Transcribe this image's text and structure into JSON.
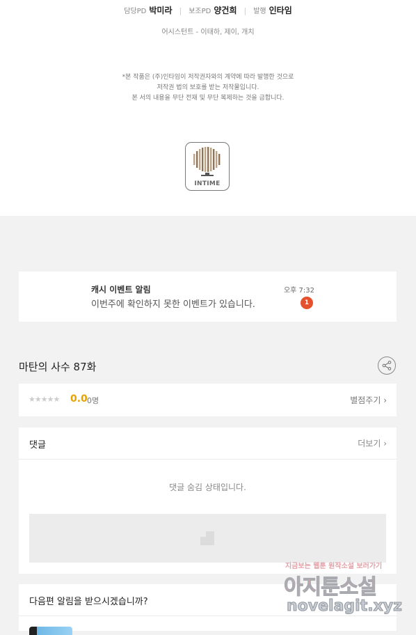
{
  "credits": {
    "lead_pd_role": "담당PD",
    "lead_pd_name": "박미라",
    "assist_pd_role": "보조PD",
    "assist_pd_name": "양건희",
    "publisher_role": "발행",
    "publisher_name": "인타임",
    "assistants": "어시스턴트 - 이태하, 제이, 개치"
  },
  "notice": {
    "line1": "*본 작품은 (주)인타임이 저작권자와의 계약에 따라 발행한 것으로",
    "line2": "저작권 법의 보호를 받는 저작물입니다.",
    "line3": "본 서의 내용을 무단 전재 및 무단 복제하는 것을 금합니다."
  },
  "logo": {
    "text": "INTIME"
  },
  "notification": {
    "title": "캐시 이벤트 알림",
    "message": "이번주에 확인하지 못한 이벤트가 있습니다.",
    "time": "오후 7:32",
    "badge": "1",
    "badge_color": "#e5512d"
  },
  "episode": {
    "title": "마탄의 사수 87화"
  },
  "rating": {
    "stars": "★★★★★",
    "score": "0.0",
    "count": "0명",
    "rate_label": "별점주기 ›",
    "score_color": "#e8a200"
  },
  "comments": {
    "title": "댓글",
    "more_label": "더보기 ›",
    "hidden_text": "댓글 숨김 상태입니다."
  },
  "next_alert": {
    "question": "다음편 알림을 받으시겠습니까?"
  },
  "watermark": {
    "line1": "지금보는 웹툰 원작소설 보러가기",
    "line2": "아지툰소설",
    "line3": "novelagit.xyz"
  }
}
